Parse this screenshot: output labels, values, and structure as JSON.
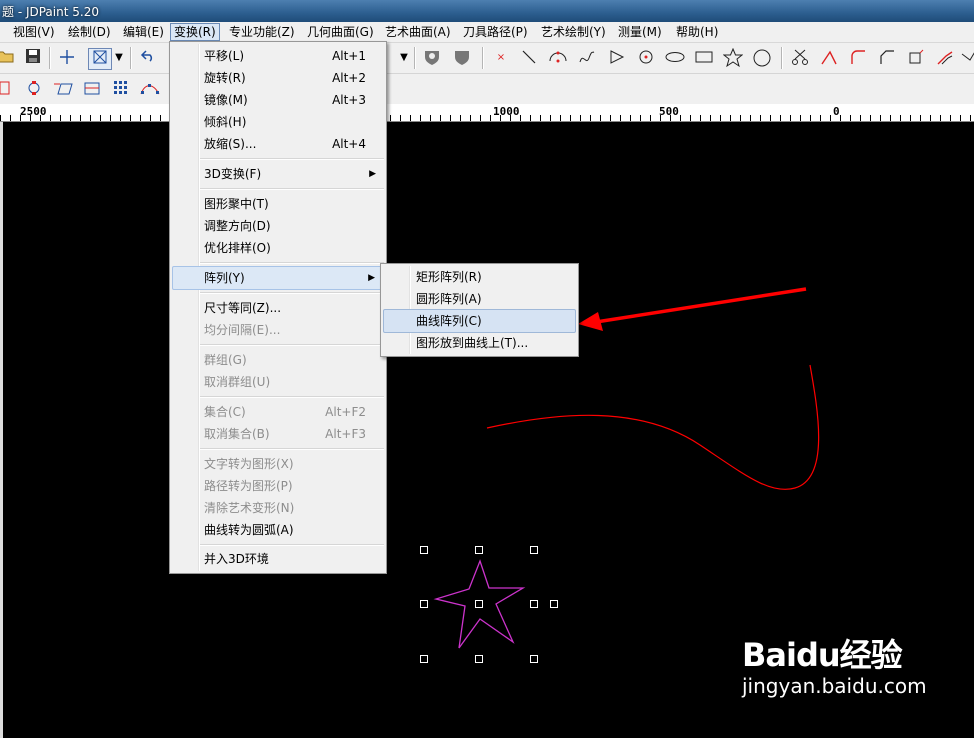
{
  "window": {
    "title": "题 - JDPaint 5.20"
  },
  "menubar": [
    {
      "label": "视图(V)"
    },
    {
      "label": "绘制(D)"
    },
    {
      "label": "编辑(E)"
    },
    {
      "label": "变换(R)"
    },
    {
      "label": "专业功能(Z)"
    },
    {
      "label": "几何曲面(G)"
    },
    {
      "label": "艺术曲面(A)"
    },
    {
      "label": "刀具路径(P)"
    },
    {
      "label": "艺术绘制(Y)"
    },
    {
      "label": "测量(M)"
    },
    {
      "label": "帮助(H)"
    }
  ],
  "ruler": {
    "labels": [
      "2500",
      "1000",
      "500",
      "0"
    ]
  },
  "transform_menu": {
    "items": [
      {
        "label": "平移(L)",
        "accel": "Alt+1"
      },
      {
        "label": "旋转(R)",
        "accel": "Alt+2"
      },
      {
        "label": "镜像(M)",
        "accel": "Alt+3"
      },
      {
        "label": "倾斜(H)",
        "accel": ""
      },
      {
        "label": "放缩(S)...",
        "accel": "Alt+4"
      },
      {
        "label": "3D变换(F)",
        "accel": ""
      },
      {
        "label": "图形聚中(T)",
        "accel": ""
      },
      {
        "label": "调整方向(D)",
        "accel": ""
      },
      {
        "label": "优化排样(O)",
        "accel": ""
      },
      {
        "label": "阵列(Y)",
        "accel": ""
      },
      {
        "label": "尺寸等同(Z)...",
        "accel": ""
      },
      {
        "label": "均分间隔(E)...",
        "accel": ""
      },
      {
        "label": "群组(G)",
        "accel": ""
      },
      {
        "label": "取消群组(U)",
        "accel": ""
      },
      {
        "label": "集合(C)",
        "accel": "Alt+F2"
      },
      {
        "label": "取消集合(B)",
        "accel": "Alt+F3"
      },
      {
        "label": "文字转为图形(X)",
        "accel": ""
      },
      {
        "label": "路径转为图形(P)",
        "accel": ""
      },
      {
        "label": "清除艺术变形(N)",
        "accel": ""
      },
      {
        "label": "曲线转为圆弧(A)",
        "accel": ""
      },
      {
        "label": "并入3D环境",
        "accel": ""
      }
    ]
  },
  "array_submenu": {
    "items": [
      {
        "label": "矩形阵列(R)"
      },
      {
        "label": "圆形阵列(A)"
      },
      {
        "label": "曲线阵列(C)"
      },
      {
        "label": "图形放到曲线上(T)..."
      }
    ]
  },
  "watermark": {
    "logo": "Baidu经验",
    "url": "jingyan.baidu.com"
  },
  "colors": {
    "curve": "#ff0000",
    "star": "#cc33cc",
    "arrow": "#ff0000",
    "menu_highlight": "#dce8f6"
  }
}
